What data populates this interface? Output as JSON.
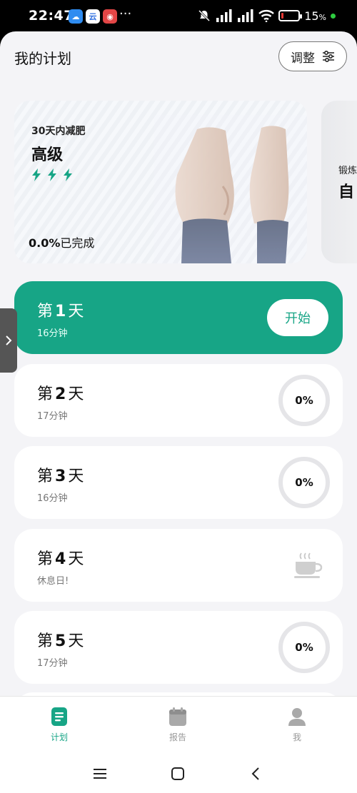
{
  "status_bar": {
    "time": "22:47",
    "app_icons": [
      "cloud-app-icon",
      "cloud-sync-icon",
      "app-icon"
    ],
    "app_glyphs": [
      "☁",
      "云",
      "◉"
    ],
    "more": "···",
    "battery_percent": "15",
    "battery_suffix": "%",
    "battery_level": 0.15
  },
  "header": {
    "title": "我的计划",
    "adjust_label": "调整"
  },
  "plan_cards": [
    {
      "subtitle": "30天内减肥",
      "level": "高级",
      "intensity_bolts": 3,
      "progress_value": "0.0%",
      "progress_suffix": "已完成"
    },
    {
      "subtitle": "锻炼",
      "title": "自"
    }
  ],
  "days": [
    {
      "prefix": "第",
      "num": "1",
      "suffix": "天",
      "sub": "16分钟",
      "action": "开始",
      "state": "active"
    },
    {
      "prefix": "第",
      "num": "2",
      "suffix": "天",
      "sub": "17分钟",
      "progress": "0%"
    },
    {
      "prefix": "第",
      "num": "3",
      "suffix": "天",
      "sub": "16分钟",
      "progress": "0%"
    },
    {
      "prefix": "第",
      "num": "4",
      "suffix": "天",
      "sub": "休息日!",
      "rest": true
    },
    {
      "prefix": "第",
      "num": "5",
      "suffix": "天",
      "sub": "17分钟",
      "progress": "0%"
    }
  ],
  "bottom_nav": {
    "plan": "计划",
    "report": "报告",
    "me": "我",
    "active": "plan"
  },
  "colors": {
    "accent": "#17a586",
    "ring": "#e5e5e8",
    "inactive": "#999999"
  }
}
